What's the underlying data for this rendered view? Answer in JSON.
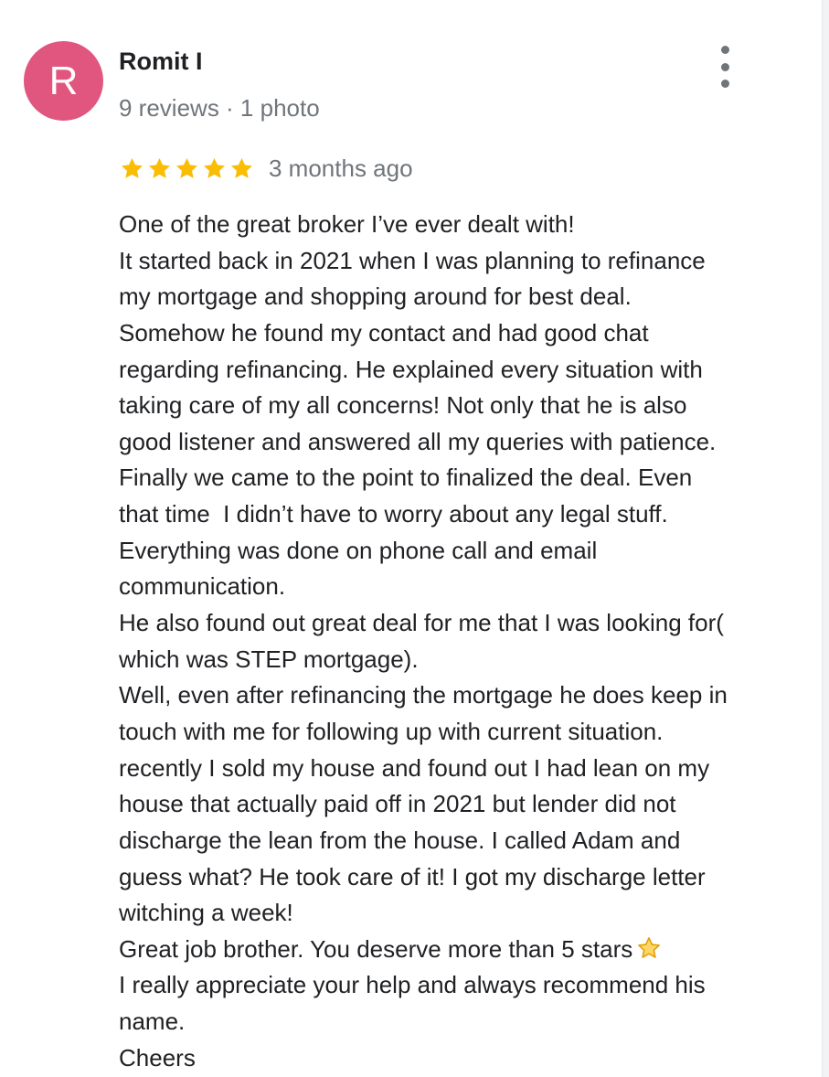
{
  "review": {
    "author": {
      "avatar_letter": "R",
      "avatar_color": "#e0567f",
      "name": "Romit I",
      "meta": "9 reviews · 1 photo"
    },
    "menu_icon": "more-vert-icon",
    "rating": {
      "stars": 5,
      "max_stars": 5,
      "star_color": "#fbbc04",
      "date": "3 months ago"
    },
    "body_lines": [
      "One of the great broker I’ve ever dealt with!",
      "It started back in 2021 when I was planning to refinance",
      "my mortgage and shopping around for best deal.",
      "Somehow he found my contact and had good chat",
      "regarding refinancing. He explained every situation with",
      "taking care of my all concerns! Not only that he is also",
      "good listener and answered all my queries with patience.",
      "Finally we came to the point to finalized the deal. Even",
      "that time  I didn’t have to worry about any legal stuff.",
      "Everything was done on phone call and email",
      "communication.",
      "He also found out great deal for me that I was looking for(",
      "which was STEP mortgage).",
      "Well, even after refinancing the mortgage he does keep in",
      "touch with me for following up with current situation.",
      "recently I sold my house and found out I had lean on my",
      "house that actually paid off in 2021 but lender did not",
      "discharge the lean from the house. I called Adam and",
      "guess what? He took care of it! I got my discharge letter",
      "witching a week!",
      "Great job brother. You deserve more than 5 stars",
      "I really appreciate your help and always recommend his",
      "name.",
      "Cheers"
    ],
    "emoji_after_line": 20,
    "emoji_icon": "star-emoji-icon"
  }
}
